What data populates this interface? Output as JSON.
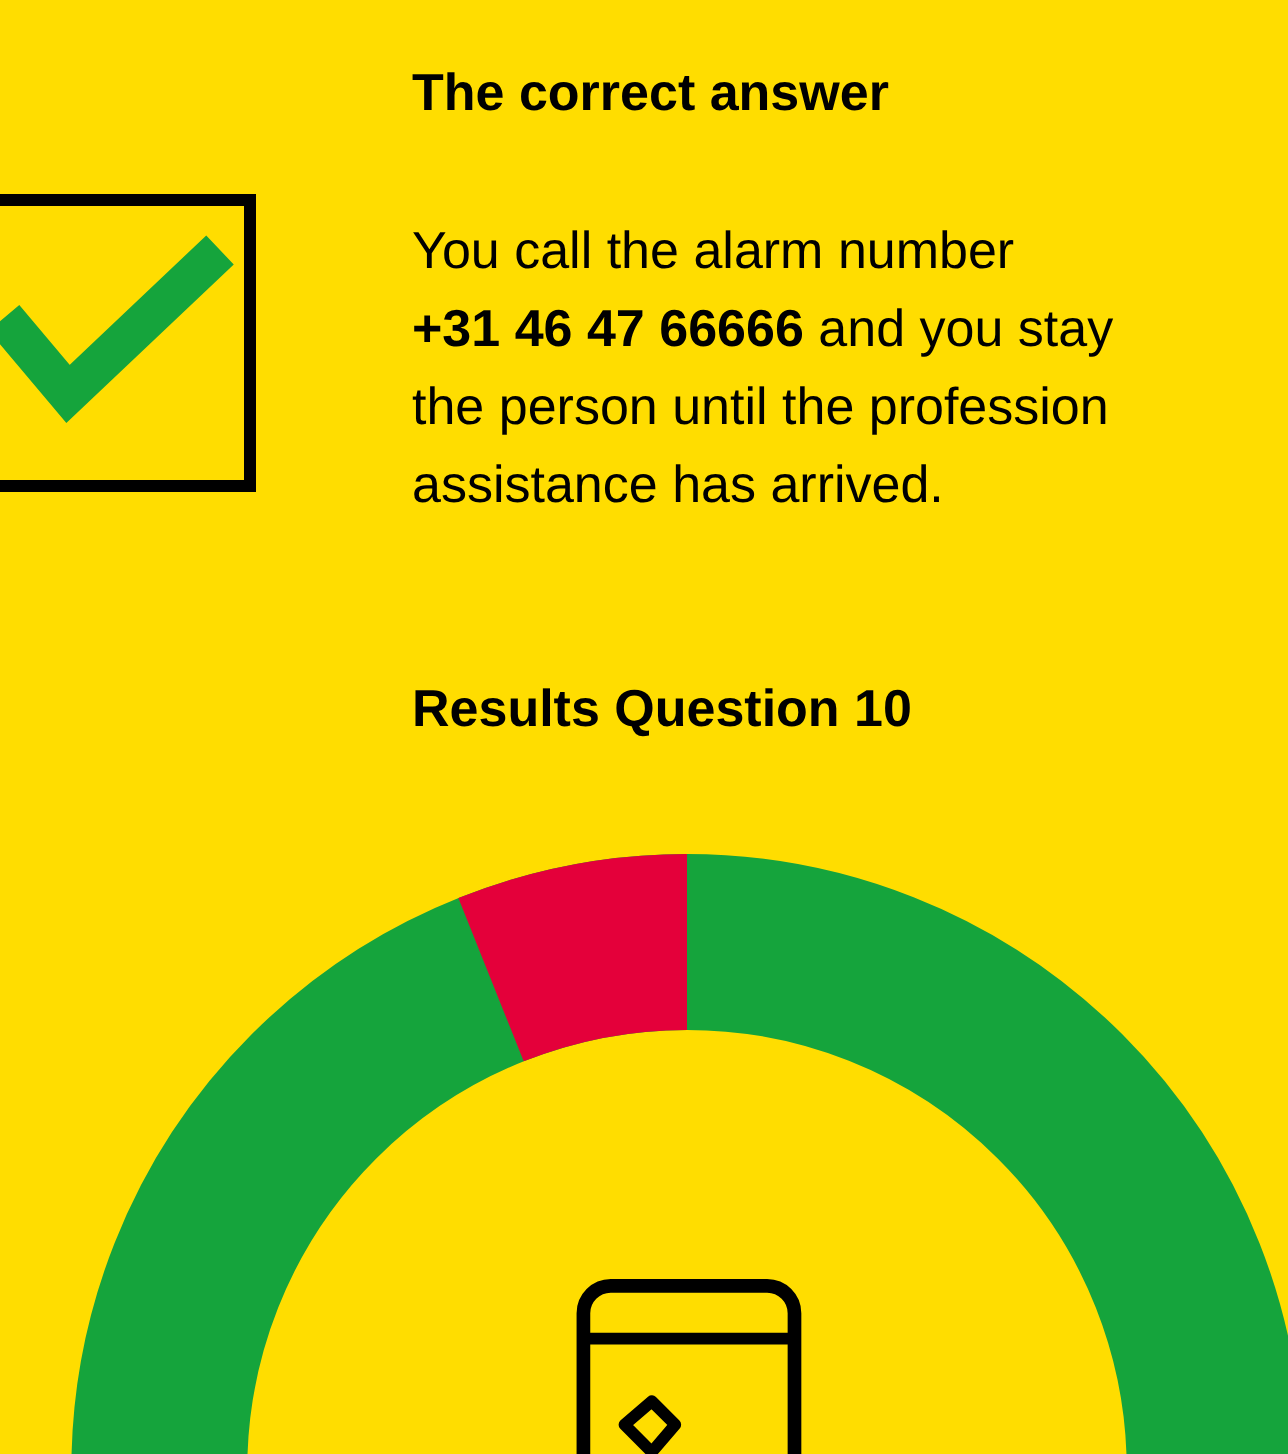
{
  "answer": {
    "heading": "The correct answer",
    "lines": [
      "You call the alarm number",
      "**+31 46 47 66666** and you stay",
      "the person until the profession",
      "assistance has arrived."
    ],
    "correct": true
  },
  "results": {
    "heading": "Results Question 10"
  }
}
